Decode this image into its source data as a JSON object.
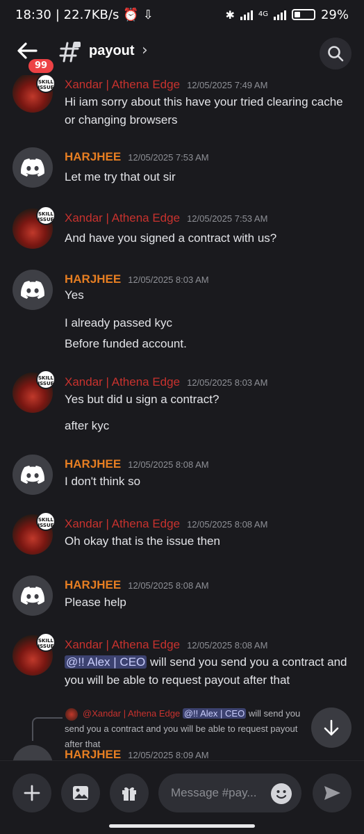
{
  "status_bar": {
    "time": "18:30",
    "speed": "| 22.7KB/s",
    "network": "4G",
    "battery": "29%",
    "battery_level": 0.29
  },
  "header": {
    "back_icon": "arrow-left-icon",
    "unread_count": "99",
    "channel_icon": "locked-channel-hash-icon",
    "channel_name": "payout",
    "search_icon": "search-icon"
  },
  "messages": [
    {
      "author": "Xandar | Athena Edge",
      "time": "12/05/2025 7:49 AM",
      "lines": [
        "Hi iam sorry about this have your tried clearing cache or changing browsers"
      ]
    },
    {
      "author": "HARJHEE",
      "time": "12/05/2025 7:53 AM",
      "lines": [
        "Let me try that out sir"
      ]
    },
    {
      "author": "Xandar | Athena Edge",
      "time": "12/05/2025 7:53 AM",
      "lines": [
        "And have you signed a contract with us?"
      ]
    },
    {
      "author": "HARJHEE",
      "time": "12/05/2025 8:03 AM",
      "lines": [
        "Yes",
        "I already passed kyc",
        "Before funded account."
      ]
    },
    {
      "author": "Xandar | Athena Edge",
      "time": "12/05/2025 8:03 AM",
      "lines": [
        "Yes but did u sign a contract?",
        "after kyc"
      ]
    },
    {
      "author": "HARJHEE",
      "time": "12/05/2025 8:08 AM",
      "lines": [
        "I don't think so"
      ]
    },
    {
      "author": "Xandar | Athena Edge",
      "time": "12/05/2025 8:08 AM",
      "lines": [
        "Oh okay that is the issue then"
      ]
    },
    {
      "author": "HARJHEE",
      "time": "12/05/2025 8:08 AM",
      "lines": [
        "Please help"
      ]
    },
    {
      "author": "Xandar | Athena Edge",
      "time": "12/05/2025 8:08 AM",
      "mention": "@!! Alex | CEO",
      "lines": [
        " will send you send you a contract and you will be able to request payout after that"
      ]
    },
    {
      "author": "HARJHEE",
      "time": "12/05/2025 8:09 AM",
      "lines": []
    }
  ],
  "skill_badge": "SKILL ISSUE",
  "reply_preview": {
    "author": "@Xandar | Athena Edge",
    "mention": "@!! Alex | CEO",
    "text": " will send you send you a contract and you will be able to request payout after that"
  },
  "composer": {
    "placeholder": "Message #pay...",
    "buttons": [
      "plus-icon",
      "image-icon",
      "gift-icon",
      "emoji-icon",
      "send-icon"
    ]
  },
  "colors": {
    "background": "#1a1a1e",
    "xandar_name": "#c8322e",
    "harjhee_name": "#e67e22",
    "mention_bg": "#3c4270",
    "badge_red": "#ed4245"
  }
}
